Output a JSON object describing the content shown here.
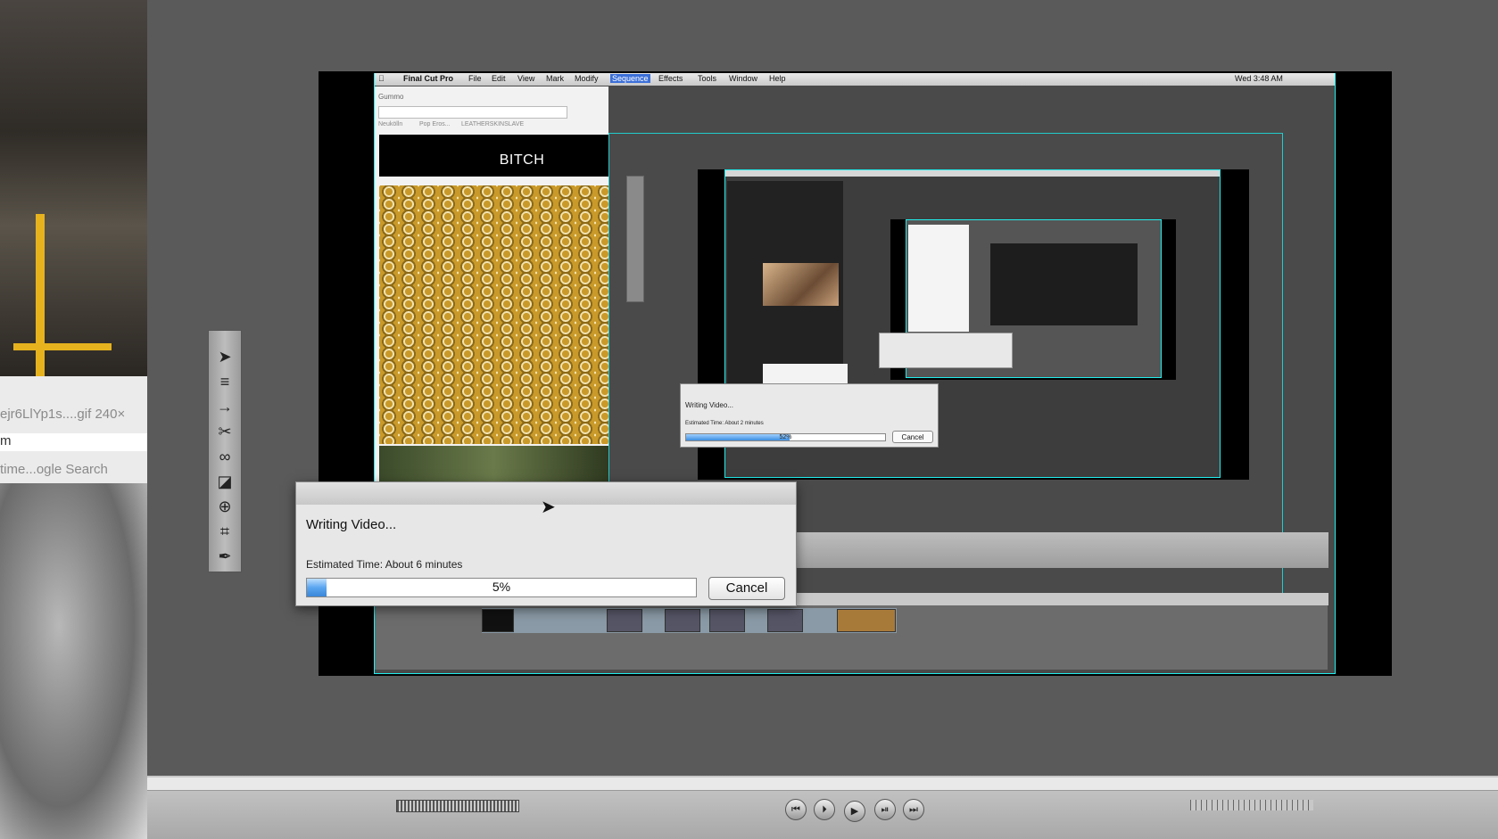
{
  "left_strip": {
    "filename": "ejr6LlYp1s....gif 240×",
    "fragment": "m",
    "search": "time...ogle Search"
  },
  "menu_bar": {
    "app": "Final Cut Pro",
    "items": [
      "File",
      "Edit",
      "View",
      "Mark",
      "Modify",
      "Sequence",
      "Effects",
      "Tools",
      "Window",
      "Help"
    ],
    "selected": "Sequence",
    "clock": "Wed 3:48 AM"
  },
  "browser": {
    "tab_label": "Gummo",
    "bookmarks": [
      "Neukölln",
      "Pop Eros...",
      "LEATHERSKINSLAVE"
    ],
    "banner_text": "BITCH"
  },
  "nested_dialog": {
    "title": "Writing Video...",
    "estimate": "Estimated Time: About 2 minutes",
    "percent_text": "52%",
    "progress": 0.52,
    "cancel": "Cancel"
  },
  "dialog": {
    "title": "Writing Video...",
    "estimate": "Estimated Time: About 6 minutes",
    "percent_text": "5%",
    "progress": 0.05,
    "cancel": "Cancel"
  },
  "tools": [
    {
      "icon": "arrow-icon",
      "glyph": "➤"
    },
    {
      "icon": "track-select-icon",
      "glyph": "≡"
    },
    {
      "icon": "ripple-icon",
      "glyph": "→"
    },
    {
      "icon": "razor-icon",
      "glyph": "✂"
    },
    {
      "icon": "slip-icon",
      "glyph": "∞"
    },
    {
      "icon": "pen-slant-icon",
      "glyph": "◪"
    },
    {
      "icon": "zoom-icon",
      "glyph": "⊕"
    },
    {
      "icon": "crop-icon",
      "glyph": "⌗"
    },
    {
      "icon": "pen-icon",
      "glyph": "✒"
    }
  ],
  "transport": [
    {
      "icon": "go-to-start-icon",
      "glyph": "⏮"
    },
    {
      "icon": "play-in-out-icon",
      "glyph": "⏵"
    },
    {
      "icon": "play-icon",
      "glyph": "▶"
    },
    {
      "icon": "play-around-icon",
      "glyph": "⏯"
    },
    {
      "icon": "go-to-end-icon",
      "glyph": "⏭"
    }
  ],
  "colors": {
    "accent": "#2ee0e0",
    "progress": "#3a86d8",
    "menu_selected": "#3b6fd8"
  }
}
